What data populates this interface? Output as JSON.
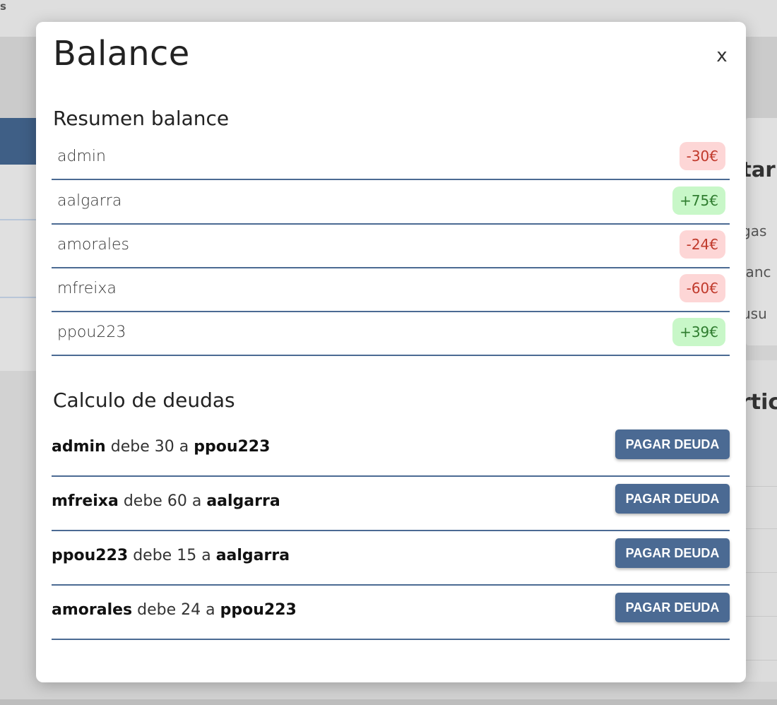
{
  "background": {
    "topbar_fragment": "s",
    "card_fragments": [
      "tar",
      "gas",
      "lanc",
      "usu"
    ],
    "card2_fragment": "rtic"
  },
  "modal": {
    "title": "Balance",
    "close_label": "x"
  },
  "summary": {
    "heading": "Resumen balance",
    "rows": [
      {
        "user": "admin",
        "amount": "-30€",
        "status": "negative"
      },
      {
        "user": "aalgarra",
        "amount": "+75€",
        "status": "positive"
      },
      {
        "user": "amorales",
        "amount": "-24€",
        "status": "negative"
      },
      {
        "user": "mfreixa",
        "amount": "-60€",
        "status": "negative"
      },
      {
        "user": "ppou223",
        "amount": "+39€",
        "status": "positive"
      }
    ]
  },
  "debts": {
    "heading": "Calculo de deudas",
    "verb": "debe",
    "connector": "a",
    "button_label": "PAGAR DEUDA",
    "rows": [
      {
        "debtor": "admin",
        "amount": "30",
        "creditor": "ppou223"
      },
      {
        "debtor": "mfreixa",
        "amount": "60",
        "creditor": "aalgarra"
      },
      {
        "debtor": "ppou223",
        "amount": "15",
        "creditor": "aalgarra"
      },
      {
        "debtor": "amorales",
        "amount": "24",
        "creditor": "ppou223"
      }
    ]
  },
  "colors": {
    "accent": "#4b6a93",
    "negative_bg": "#fdd6d6",
    "negative_text": "#c0392b",
    "positive_bg": "#c8f7c8",
    "positive_text": "#2f7d2f"
  }
}
